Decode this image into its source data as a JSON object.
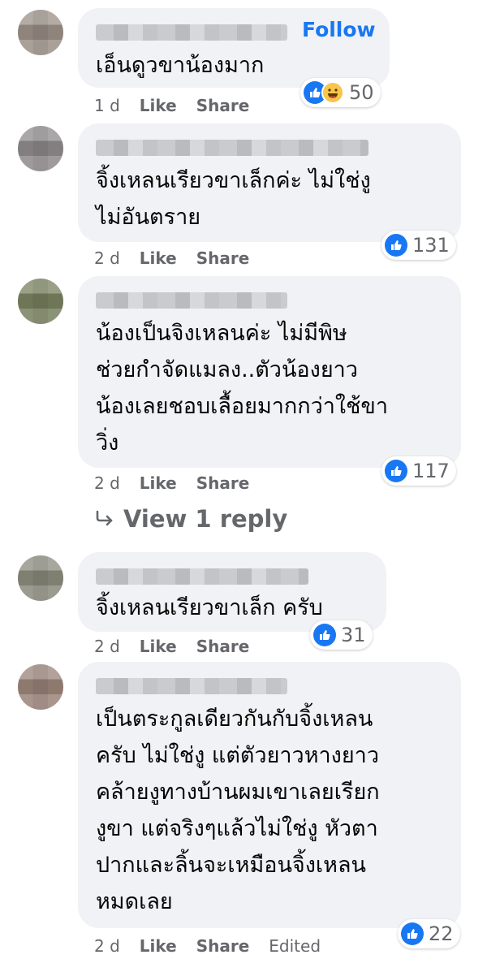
{
  "colors": {
    "bubble": "#f0f2f5",
    "link": "#1877f2",
    "meta": "#65676b",
    "like": "#1877f2",
    "haha": "#f7c64b"
  },
  "comments": [
    {
      "follow_label": "Follow",
      "text": "เอ็นดูวขาน้องมาก",
      "reaction_icons": [
        "like-icon",
        "haha-icon"
      ],
      "reaction_count": "50",
      "time": "1 d",
      "like_label": "Like",
      "share_label": "Share"
    },
    {
      "text": "จิ้งเหลนเรียวขาเล็กค่ะ ไม่ใช่งู\nไม่อันตราย",
      "reaction_icons": [
        "like-icon"
      ],
      "reaction_count": "131",
      "time": "2 d",
      "like_label": "Like",
      "share_label": "Share"
    },
    {
      "text": "น้องเป็นจิงเหลนค่ะ ไม่มีพิษ\nช่วยกำจัดแมลง..ตัวน้องยาว\nน้องเลยชอบเลื้อยมากกว่าใช้ขา\nวิ่ง",
      "reaction_icons": [
        "like-icon"
      ],
      "reaction_count": "117",
      "time": "2 d",
      "like_label": "Like",
      "share_label": "Share"
    },
    {
      "text": "จิ้งเหลนเรียวขาเล็ก ครับ",
      "reaction_icons": [
        "like-icon"
      ],
      "reaction_count": "31",
      "time": "2 d",
      "like_label": "Like",
      "share_label": "Share"
    },
    {
      "text": "เป็นตระกูลเดียวกันกับจิ้งเหลน\nครับ ไม่ใช่งู แต่ตัวยาวหางยาว\nคล้ายงูทางบ้านผมเขาเลยเรียก\nงูขา แต่จริงๆแล้วไม่ใช่งู หัวตา\nปากและลิ้นจะเหมือนจิ้งเหลน\nหมดเลย",
      "reaction_icons": [
        "like-icon"
      ],
      "reaction_count": "22",
      "time": "2 d",
      "like_label": "Like",
      "share_label": "Share",
      "edited_label": "Edited"
    }
  ],
  "view_replies_label": "View 1 reply"
}
